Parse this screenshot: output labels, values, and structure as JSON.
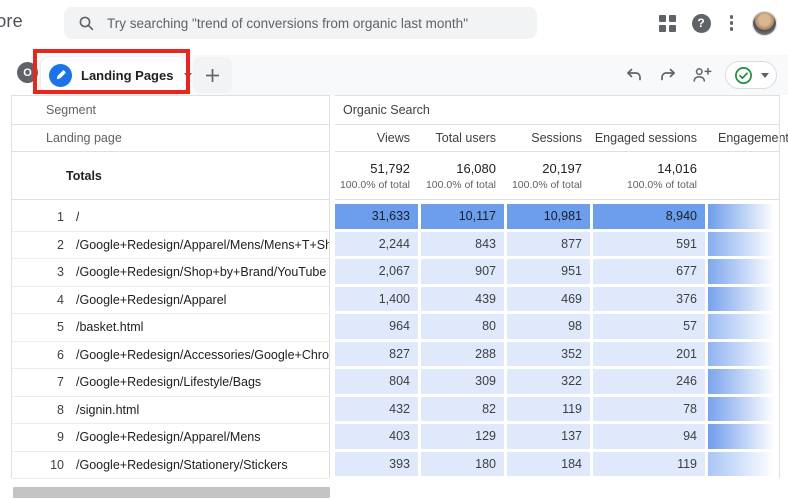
{
  "topbar": {
    "brand_clipped": "tore",
    "search_placeholder": "Try searching \"trend of conversions from organic last month\"",
    "help_glyph": "?",
    "icons": [
      "search-icon",
      "apps-grid-icon",
      "help-icon",
      "kebab-menu-icon",
      "user-avatar"
    ]
  },
  "tabbar": {
    "badge": "O",
    "tab_label": "Landing Pages",
    "icons": [
      "edit-pencil-icon",
      "dropdown-caret-icon",
      "add-tab-icon",
      "undo-icon",
      "redo-icon",
      "person-add-icon",
      "saved-check-icon"
    ]
  },
  "table": {
    "segment_label": "Segment",
    "dimension_label": "Landing page",
    "group_header": "Organic Search",
    "totals_label": "Totals",
    "columns": [
      "Views",
      "Total users",
      "Sessions",
      "Engaged sessions",
      "Engagement rate"
    ],
    "totals": [
      {
        "value": "51,792",
        "sub": "100.0% of total"
      },
      {
        "value": "16,080",
        "sub": "100.0% of total"
      },
      {
        "value": "20,197",
        "sub": "100.0% of total"
      },
      {
        "value": "14,016",
        "sub": "100.0% of total"
      },
      {
        "value": "",
        "sub": ""
      }
    ],
    "rows": [
      {
        "rank": "1",
        "page": "/",
        "views": "31,633",
        "total_users": "10,117",
        "sessions": "10,981",
        "engaged_sessions": "8,940",
        "highlight": true,
        "heat": "#6d9eeb"
      },
      {
        "rank": "2",
        "page": "/Google+Redesign/Apparel/Mens/Mens+T+Shirts",
        "views": "2,244",
        "total_users": "843",
        "sessions": "877",
        "engaged_sessions": "591",
        "highlight": false,
        "heat": "#86adf0"
      },
      {
        "rank": "3",
        "page": "/Google+Redesign/Shop+by+Brand/YouTube",
        "views": "2,067",
        "total_users": "907",
        "sessions": "951",
        "engaged_sessions": "677",
        "highlight": false,
        "heat": "#7da7ee"
      },
      {
        "rank": "4",
        "page": "/Google+Redesign/Apparel",
        "views": "1,400",
        "total_users": "439",
        "sessions": "469",
        "engaged_sessions": "376",
        "highlight": false,
        "heat": "#76a2ed"
      },
      {
        "rank": "5",
        "page": "/basket.html",
        "views": "964",
        "total_users": "80",
        "sessions": "98",
        "engaged_sessions": "57",
        "highlight": false,
        "heat": "#9bbcf3"
      },
      {
        "rank": "6",
        "page": "/Google+Redesign/Accessories/Google+Chrome+Din..",
        "views": "827",
        "total_users": "288",
        "sessions": "352",
        "engaged_sessions": "201",
        "highlight": false,
        "heat": "#8fb3f1"
      },
      {
        "rank": "7",
        "page": "/Google+Redesign/Lifestyle/Bags",
        "views": "804",
        "total_users": "309",
        "sessions": "322",
        "engaged_sessions": "246",
        "highlight": false,
        "heat": "#7aa5ee"
      },
      {
        "rank": "8",
        "page": "/signin.html",
        "views": "432",
        "total_users": "82",
        "sessions": "119",
        "engaged_sessions": "78",
        "highlight": false,
        "heat": "#77a2ed"
      },
      {
        "rank": "9",
        "page": "/Google+Redesign/Apparel/Mens",
        "views": "403",
        "total_users": "129",
        "sessions": "137",
        "engaged_sessions": "94",
        "highlight": false,
        "heat": "#709dec"
      },
      {
        "rank": "10",
        "page": "/Google+Redesign/Stationery/Stickers",
        "views": "393",
        "total_users": "180",
        "sessions": "184",
        "engaged_sessions": "119",
        "highlight": false,
        "heat": "#aac6f5"
      }
    ]
  },
  "colors": {
    "accent_blue": "#1a73e8",
    "heat_solid": "#6d9eeb",
    "cell_light": "#dfe9fb",
    "annotation_red": "#e8261d",
    "status_green": "#1e8e3e",
    "icon_gray": "#5f6368"
  }
}
